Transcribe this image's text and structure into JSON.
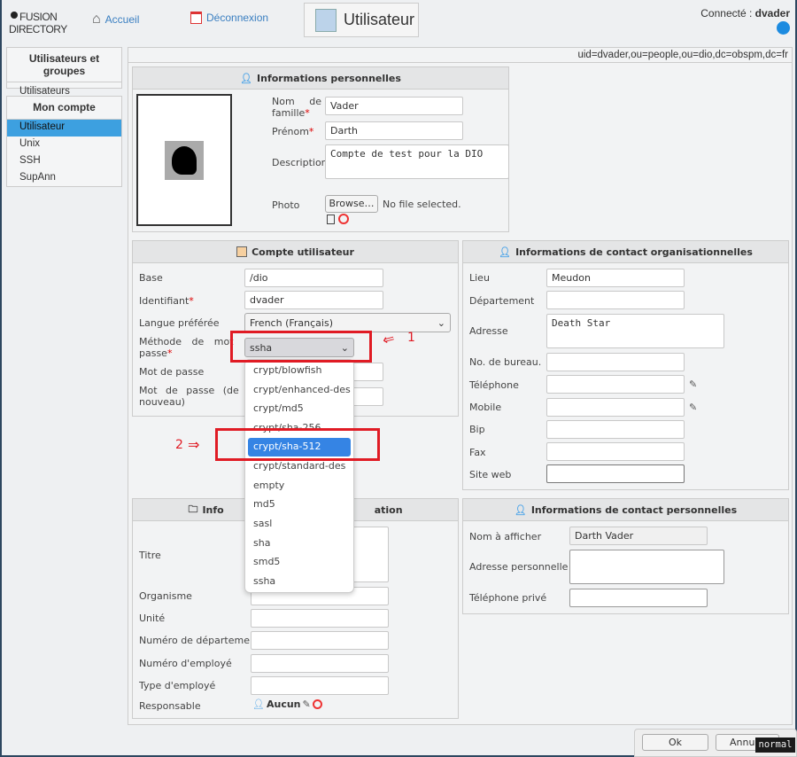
{
  "header": {
    "logo_line1": "FUSION",
    "logo_line2": "DIRECTORY",
    "home": "Accueil",
    "logout": "Déconnexion",
    "page_title": "Utilisateur",
    "connected_label": "Connecté :",
    "connected_user": "dvader"
  },
  "sidebar": {
    "group1_title": "Utilisateurs et groupes",
    "group1_items": [
      "Utilisateurs"
    ],
    "group2_title": "Mon compte",
    "group2_items": [
      "Utilisateur",
      "Unix",
      "SSH",
      "SupAnn"
    ],
    "selected": "Utilisateur"
  },
  "dn": "uid=dvader,ou=people,ou=dio,dc=obspm,dc=fr",
  "personal": {
    "title": "Informations personnelles",
    "nom_label1": "Nom",
    "nom_label2": "de",
    "nom_label3": "famille",
    "nom": "Vader",
    "prenom_label": "Prénom",
    "prenom": "Darth",
    "description_label": "Description",
    "description": "Compte de test pour la DIO",
    "photo_label": "Photo",
    "browse": "Browse…",
    "no_file": "No file selected."
  },
  "account": {
    "title": "Compte utilisateur",
    "base_label": "Base",
    "base": "/dio",
    "id_label": "Identifiant",
    "id": "dvader",
    "lang_label": "Langue préférée",
    "lang": "French (Français)",
    "method_label": "Méthode de mot de passe",
    "method": "ssha",
    "pwd_label": "Mot de passe",
    "pwd2_label": "Mot de passe (de nouveau)"
  },
  "dropdown": {
    "options": [
      "crypt/blowfish",
      "crypt/enhanced-des",
      "crypt/md5",
      "crypt/sha-256",
      "crypt/sha-512",
      "crypt/standard-des",
      "empty",
      "md5",
      "sasl",
      "sha",
      "smd5",
      "ssha"
    ],
    "highlighted": "crypt/sha-512"
  },
  "annotations": {
    "one": "1",
    "two": "2",
    "color": "#e01b24"
  },
  "org_contact": {
    "title": "Informations de contact organisationnelles",
    "lieu_label": "Lieu",
    "lieu": "Meudon",
    "dept_label": "Département",
    "adresse_label": "Adresse",
    "adresse": "Death Star",
    "bureau_label": "No. de bureau.",
    "tel_label": "Téléphone",
    "mobile_label": "Mobile",
    "bip_label": "Bip",
    "fax_label": "Fax",
    "web_label": "Site web"
  },
  "org_info": {
    "title_left": "Info",
    "title_right": "ation",
    "titre_label": "Titre",
    "organisme_label": "Organisme",
    "unite_label": "Unité",
    "numdept_label": "Numéro de département",
    "numemp_label": "Numéro d'employé",
    "typeemp_label": "Type d'employé",
    "resp_label": "Responsable",
    "resp_value": "Aucun"
  },
  "personal_contact": {
    "title": "Informations de contact personnelles",
    "display_label": "Nom à afficher",
    "display": "Darth Vader",
    "home_addr_label": "Adresse personnelle",
    "home_phone_label": "Téléphone privé"
  },
  "footer": {
    "ok": "Ok",
    "cancel": "Annul",
    "mode_badge": "normal"
  },
  "colors": {
    "accent": "#3da0e0",
    "selection": "#3584e4",
    "link": "#3a7fc1"
  }
}
